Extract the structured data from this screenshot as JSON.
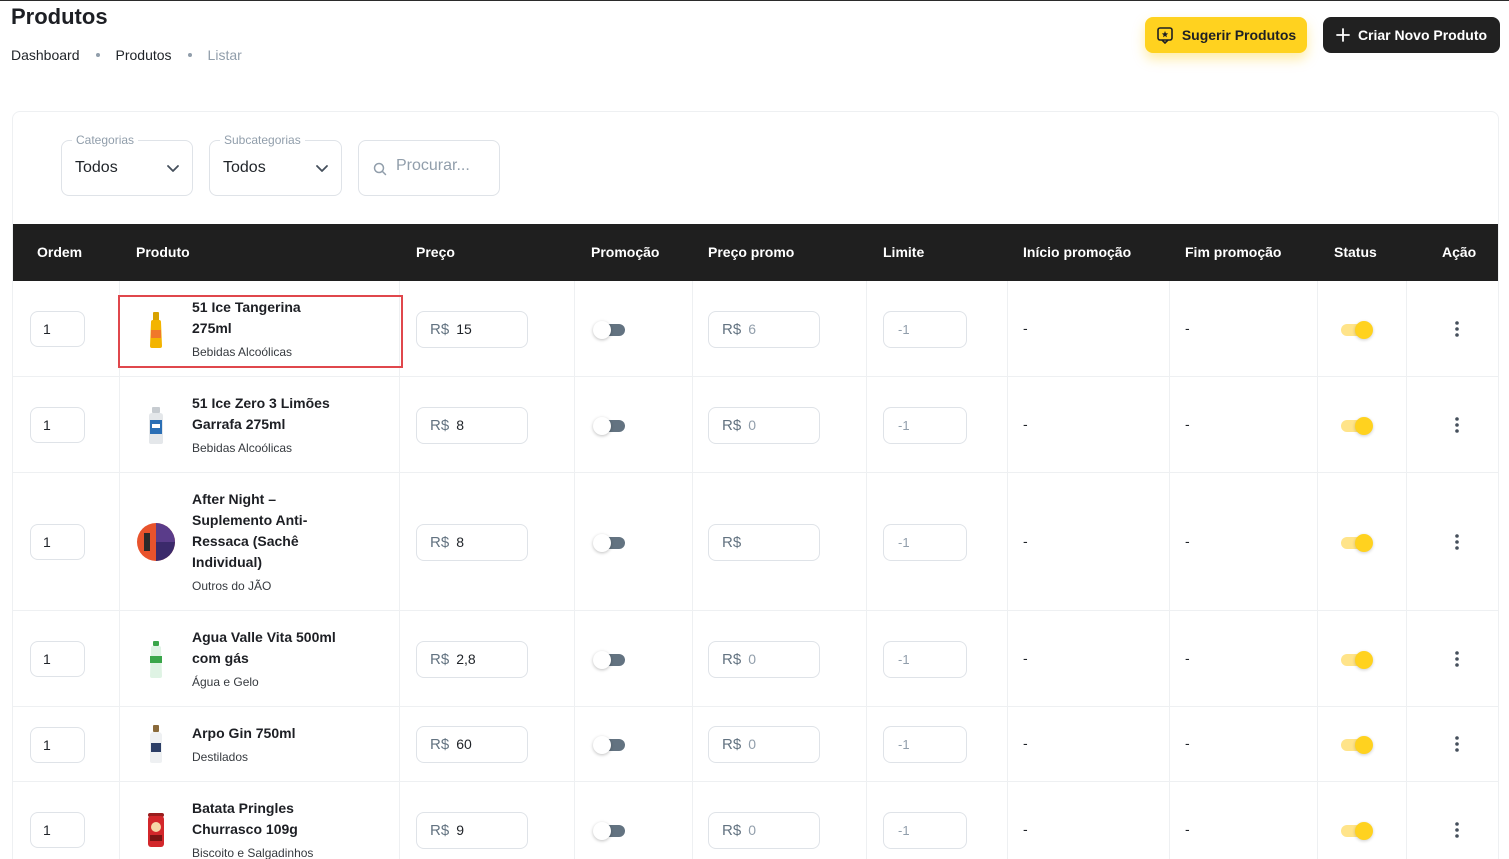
{
  "page": {
    "title": "Produtos"
  },
  "breadcrumb": {
    "items": [
      "Dashboard",
      "Produtos",
      "Listar"
    ]
  },
  "actions": {
    "suggest_label": "Sugerir Produtos",
    "create_label": "Criar Novo Produto"
  },
  "filters": {
    "categories": {
      "label": "Categorias",
      "value": "Todos"
    },
    "subcategories": {
      "label": "Subcategorias",
      "value": "Todos"
    },
    "search": {
      "placeholder": "Procurar..."
    }
  },
  "columns": [
    "Ordem",
    "Produto",
    "Preço",
    "Promoção",
    "Preço promo",
    "Limite",
    "Início promoção",
    "Fim promoção",
    "Status",
    "Ação"
  ],
  "currency": "R$",
  "rows": [
    {
      "ordem": "1",
      "name_lines": [
        "51 Ice Tangerina",
        "275ml"
      ],
      "category": "Bebidas Alcoólicas",
      "price": "15",
      "promo_on": false,
      "promo_price": "6",
      "limit": "-1",
      "start": "-",
      "end": "-",
      "status_on": true
    },
    {
      "ordem": "1",
      "name_lines": [
        "51 Ice Zero 3 Limões",
        "Garrafa 275ml"
      ],
      "category": "Bebidas Alcoólicas",
      "price": "8",
      "promo_on": false,
      "promo_price": "0",
      "limit": "-1",
      "start": "-",
      "end": "-",
      "status_on": true
    },
    {
      "ordem": "1",
      "name_lines": [
        "After Night –",
        "Suplemento Anti-",
        "Ressaca (Sachê",
        "Individual)"
      ],
      "category": "Outros do JÃO",
      "price": "8",
      "promo_on": false,
      "promo_price": "",
      "limit": "-1",
      "start": "-",
      "end": "-",
      "status_on": true
    },
    {
      "ordem": "1",
      "name_lines": [
        "Agua Valle Vita 500ml",
        "com gás"
      ],
      "category": "Água e Gelo",
      "price": "2,8",
      "promo_on": false,
      "promo_price": "0",
      "limit": "-1",
      "start": "-",
      "end": "-",
      "status_on": true
    },
    {
      "ordem": "1",
      "name_lines": [
        "Arpo Gin 750ml"
      ],
      "category": "Destilados",
      "price": "60",
      "promo_on": false,
      "promo_price": "0",
      "limit": "-1",
      "start": "-",
      "end": "-",
      "status_on": true
    },
    {
      "ordem": "1",
      "name_lines": [
        "Batata Pringles",
        "Churrasco 109g"
      ],
      "category": "Biscoito e Salgadinhos",
      "price": "9",
      "promo_on": false,
      "promo_price": "0",
      "limit": "-1",
      "start": "-",
      "end": "-",
      "status_on": true
    }
  ],
  "colors": {
    "accent": "#ffd21f",
    "header_bg": "#1f1f1f",
    "highlight": "#e0474c"
  }
}
